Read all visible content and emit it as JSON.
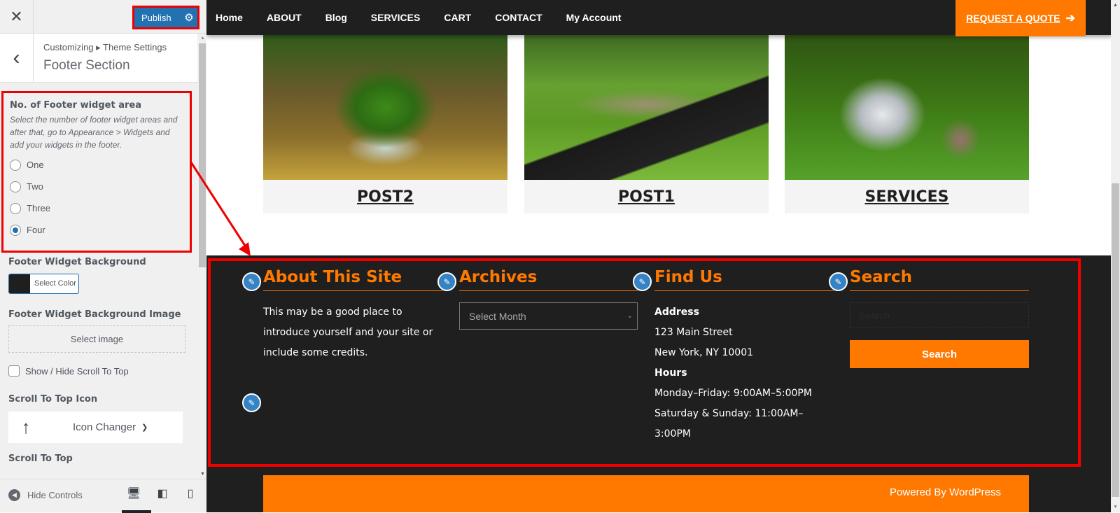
{
  "sidebar": {
    "close_icon": "✕",
    "publish_label": "Publish",
    "gear_icon": "⚙",
    "back_icon": "‹",
    "breadcrumb": "Customizing ▸ Theme Settings",
    "section_title": "Footer Section",
    "footer_widget_area": {
      "title": "No. of Footer widget area",
      "description": "Select the number of footer widget areas and after that, go to Appearance > Widgets and add your widgets in the footer.",
      "options": [
        {
          "label": "One",
          "checked": false
        },
        {
          "label": "Two",
          "checked": false
        },
        {
          "label": "Three",
          "checked": false
        },
        {
          "label": "Four",
          "checked": true
        }
      ]
    },
    "bg_label": "Footer Widget Background",
    "bg_color_value": "#1f1f1f",
    "select_color_label": "Select Color",
    "bg_image_label": "Footer Widget Background Image",
    "select_image_label": "Select image",
    "show_hide_scroll_label": "Show / Hide Scroll To Top",
    "show_hide_scroll_checked": false,
    "scroll_icon_label": "Scroll To Top Icon",
    "icon_changer_arrow": "🠕",
    "icon_changer_label": "Icon Changer",
    "icon_changer_chevron": "⌄",
    "scroll_to_top_label": "Scroll To Top",
    "hide_controls_label": "Hide Controls",
    "devices": [
      "desktop",
      "tablet",
      "mobile"
    ],
    "active_device": "desktop"
  },
  "preview": {
    "nav": [
      "Home",
      "ABOUT",
      "Blog",
      "SERVICES",
      "CART",
      "CONTACT",
      "My Account"
    ],
    "quote_label": "REQUEST A QUOTE",
    "quote_arrow": "➔",
    "cards": [
      {
        "title": "POST2",
        "image": "tree-in-glass-sphere"
      },
      {
        "title": "POST1",
        "image": "laptop-on-grass"
      },
      {
        "title": "SERVICES",
        "image": "light-bulb-on-grass"
      }
    ],
    "footer": {
      "about": {
        "title": "About This Site",
        "text": "This may be a good place to introduce yourself and your site or include some credits."
      },
      "archives": {
        "title": "Archives",
        "select_placeholder": "Select Month"
      },
      "find_us": {
        "title": "Find Us",
        "address_label": "Address",
        "address_line1": "123 Main Street",
        "address_line2": "New York, NY 10001",
        "hours_label": "Hours",
        "hours_line1": "Monday–Friday: 9:00AM–5:00PM",
        "hours_line2": "Saturday & Sunday: 11:00AM–",
        "hours_line3": "3:00PM"
      },
      "search": {
        "title": "Search",
        "placeholder": "Search",
        "button_label": "Search"
      },
      "copyright": "Powered By WordPress"
    },
    "edit_icon": "✎"
  },
  "colors": {
    "accent_orange": "#ff7800",
    "publish_blue": "#2271b1",
    "highlight_red": "#ee0000",
    "footer_bg": "#1f1f1f"
  }
}
